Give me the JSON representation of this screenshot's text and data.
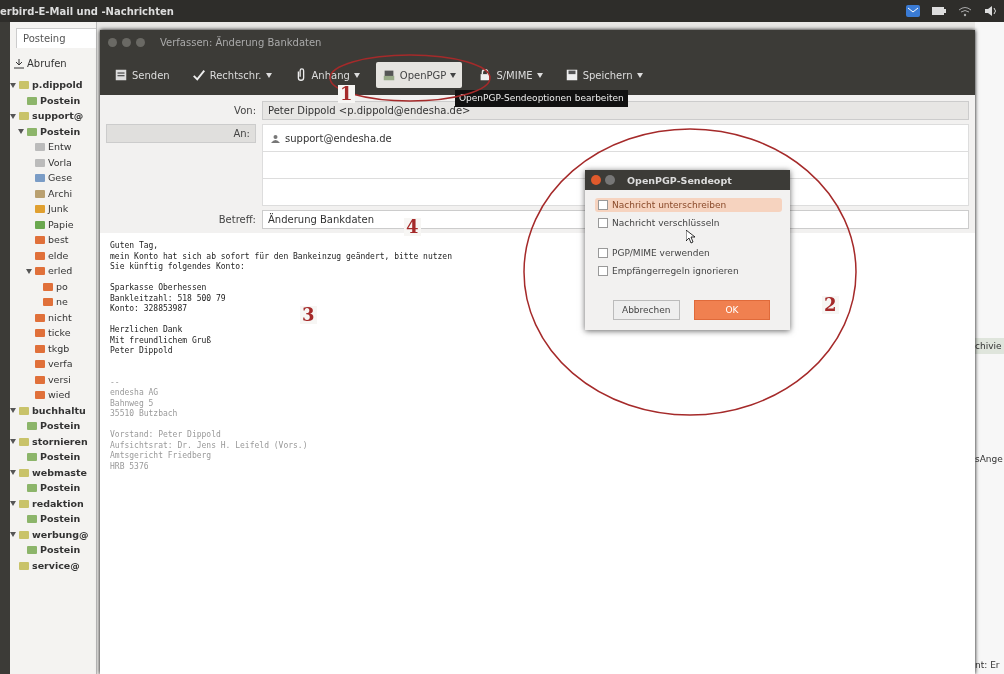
{
  "top_bar": {
    "title": "erbird-E-Mail und -Nachrichten"
  },
  "main_window": {
    "tab": "Posteing",
    "fetch_button": "Abrufen",
    "folders": [
      {
        "label": "p.dippold",
        "kind": "account",
        "children": [
          {
            "label": "Postein",
            "kind": "inbox"
          }
        ]
      },
      {
        "label": "support@",
        "kind": "account",
        "children": [
          {
            "label": "Postein",
            "kind": "inbox",
            "children": [
              {
                "label": "Entw",
                "kind": "drafts"
              },
              {
                "label": "Vorla",
                "kind": "drafts"
              },
              {
                "label": "Gese",
                "kind": "sent"
              },
              {
                "label": "Archi",
                "kind": "archive"
              },
              {
                "label": "Junk",
                "kind": "junk"
              },
              {
                "label": "Papie",
                "kind": "trash"
              },
              {
                "label": "best",
                "kind": "folder"
              },
              {
                "label": "elde",
                "kind": "folder"
              },
              {
                "label": "erled",
                "kind": "folder",
                "children": [
                  {
                    "label": "po",
                    "kind": "folder"
                  },
                  {
                    "label": "ne",
                    "kind": "folder"
                  }
                ]
              },
              {
                "label": "nicht",
                "kind": "folder"
              },
              {
                "label": "ticke",
                "kind": "folder"
              },
              {
                "label": "tkgb",
                "kind": "folder"
              },
              {
                "label": "verfa",
                "kind": "folder"
              },
              {
                "label": "versi",
                "kind": "folder"
              },
              {
                "label": "wied",
                "kind": "folder"
              }
            ]
          }
        ]
      },
      {
        "label": "buchhaltu",
        "kind": "account",
        "children": [
          {
            "label": "Postein",
            "kind": "inbox"
          }
        ]
      },
      {
        "label": "stornieren",
        "kind": "account",
        "children": [
          {
            "label": "Postein",
            "kind": "inbox"
          }
        ]
      },
      {
        "label": "webmaste",
        "kind": "account",
        "children": [
          {
            "label": "Postein",
            "kind": "inbox"
          }
        ]
      },
      {
        "label": "redaktion",
        "kind": "account",
        "children": [
          {
            "label": "Postein",
            "kind": "inbox"
          }
        ]
      },
      {
        "label": "werbung@",
        "kind": "account",
        "children": [
          {
            "label": "Postein",
            "kind": "inbox"
          }
        ]
      },
      {
        "label": "service@",
        "kind": "account"
      }
    ],
    "right_fragments": [
      "chivie",
      "sAnge",
      "nt: Er"
    ]
  },
  "compose": {
    "title": "Verfassen: Änderung Bankdaten",
    "toolbar": [
      {
        "label": "Senden",
        "kind": "send",
        "dropdown": false,
        "selected": false
      },
      {
        "label": "Rechtschr.",
        "kind": "spell",
        "dropdown": true,
        "selected": false
      },
      {
        "label": "Anhang",
        "kind": "attach",
        "dropdown": true,
        "selected": false
      },
      {
        "label": "OpenPGP",
        "kind": "openpgp",
        "dropdown": true,
        "selected": true
      },
      {
        "label": "S/MIME",
        "kind": "smime",
        "dropdown": true,
        "selected": false
      },
      {
        "label": "Speichern",
        "kind": "save",
        "dropdown": true,
        "selected": false
      }
    ],
    "tooltip": "OpenPGP-Sendeoptionen bearbeiten",
    "from_label": "Von:",
    "from": "Peter Dippold <p.dippold@endesha.de>",
    "to_label": "An:",
    "to": "support@endesha.de",
    "subject_label": "Betreff:",
    "subject": "Änderung Bankdaten",
    "body": [
      {
        "text": "Guten Tag,",
        "kind": "text"
      },
      {
        "text": "mein Konto hat sich ab sofort für den Bankeinzug geändert, bitte nutzen",
        "kind": "text"
      },
      {
        "text": "Sie künftig folgendes Konto:",
        "kind": "text"
      },
      {
        "kind": "blank"
      },
      {
        "text": "Sparkasse Oberhessen",
        "kind": "text"
      },
      {
        "text": "Bankleitzahl: 518 500 79",
        "kind": "text"
      },
      {
        "text": "Konto: 328853987",
        "kind": "text"
      },
      {
        "kind": "blank"
      },
      {
        "text": "Herzlichen Dank",
        "kind": "text"
      },
      {
        "text": "Mit freundlichem Gruß",
        "kind": "text"
      },
      {
        "text": "Peter Dippold",
        "kind": "text"
      },
      {
        "kind": "blank"
      },
      {
        "kind": "blank"
      },
      {
        "text": "--",
        "kind": "signature"
      },
      {
        "text": "endesha AG",
        "kind": "signature"
      },
      {
        "text": "Bahnweg 5",
        "kind": "signature"
      },
      {
        "text": "35510 Butzbach",
        "kind": "signature"
      },
      {
        "kind": "blank"
      },
      {
        "text": "Vorstand: Peter Dippold",
        "kind": "signature"
      },
      {
        "text": "Aufsichtsrat: Dr. Jens H. Leifeld (Vors.)",
        "kind": "signature"
      },
      {
        "text": "Amtsgericht Friedberg",
        "kind": "signature"
      },
      {
        "text": "HRB 5376",
        "kind": "signature"
      }
    ]
  },
  "dialog": {
    "title": "OpenPGP-Sendeopt",
    "option_groups": [
      [
        {
          "label": "Nachricht unterschreiben",
          "checked": false,
          "selected": true
        },
        {
          "label": "Nachricht verschlüsseln",
          "checked": false,
          "selected": false
        }
      ],
      [
        {
          "label": "PGP/MIME verwenden",
          "checked": false,
          "selected": false
        },
        {
          "label": "Empfängerregeln ignorieren",
          "checked": false,
          "selected": false
        }
      ]
    ],
    "buttons": [
      {
        "label": "Abbrechen",
        "default": false
      },
      {
        "label": "OK",
        "default": true
      }
    ]
  },
  "annotations": [
    "1",
    "2",
    "3",
    "4"
  ]
}
